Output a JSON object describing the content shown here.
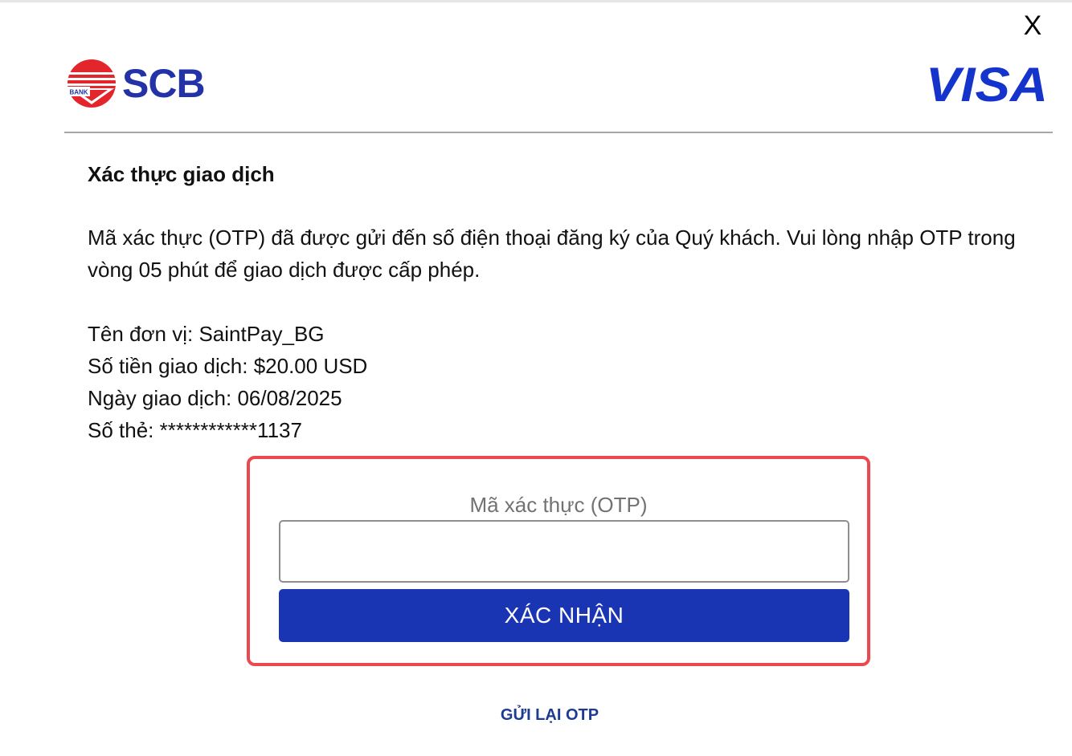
{
  "header": {
    "close_label": "X",
    "bank_logo_text": "SCB",
    "bank_logo_badge": "BANK",
    "card_brand": "VISA"
  },
  "content": {
    "title": "Xác thực giao dịch",
    "description": "Mã xác thực (OTP) đã được gửi đến số điện thoại đăng ký của Quý khách. Vui lòng nhập OTP trong vòng 05 phút để giao dịch được cấp phép.",
    "merchant": "Tên đơn vị: SaintPay_BG",
    "amount": "Số tiền giao dịch: $20.00 USD",
    "date": "Ngày giao dịch: 06/08/2025",
    "card_number": "Số thẻ: ************1137"
  },
  "otp_form": {
    "label": "Mã xác thực (OTP)",
    "value": "",
    "placeholder": "",
    "submit_label": "XÁC NHẬN"
  },
  "resend_label": "GỬI LẠI OTP",
  "colors": {
    "brand_blue": "#1a35b4",
    "scb_red": "#e3262c",
    "visa_blue": "#1434cb",
    "highlight_border": "#e84a4f"
  }
}
